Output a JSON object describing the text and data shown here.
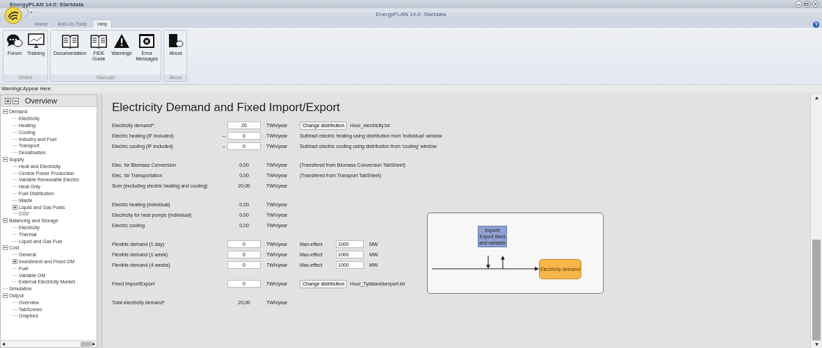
{
  "window": {
    "title": "EnergyPLAN 14.0: Startdata"
  },
  "app_title": "EnergyPLAN 14.0: Startdata",
  "tabs": [
    {
      "label": "Home",
      "selected": false
    },
    {
      "label": "Add-On Tools",
      "selected": false
    },
    {
      "label": "Help",
      "selected": true
    }
  ],
  "ribbon_groups": [
    {
      "label": "Online",
      "buttons": [
        "Forum",
        "Training"
      ]
    },
    {
      "label": "Manuals",
      "buttons": [
        "Documentation",
        "FIDE Guide",
        "Warnings",
        "Error Messages"
      ]
    },
    {
      "label": "About",
      "buttons": [
        "About"
      ]
    }
  ],
  "warnings_label": "Warnings Appear Here:",
  "sidebar": {
    "title": "Overview",
    "tree": [
      {
        "label": "Demand",
        "expanded": true,
        "children": [
          {
            "label": "Electricity"
          },
          {
            "label": "Heating"
          },
          {
            "label": "Cooling"
          },
          {
            "label": "Industry and Fuel"
          },
          {
            "label": "Transport"
          },
          {
            "label": "Desalination"
          }
        ]
      },
      {
        "label": "Supply",
        "expanded": true,
        "children": [
          {
            "label": "Heat and Electricity"
          },
          {
            "label": "Central Power Production"
          },
          {
            "label": "Variable Renewable Electric"
          },
          {
            "label": "Heat Only"
          },
          {
            "label": "Fuel Distribution"
          },
          {
            "label": "Waste"
          },
          {
            "label": "Liquid and Gas Fuels",
            "expanded": false
          },
          {
            "label": "CO2"
          }
        ]
      },
      {
        "label": "Balancing and Storage",
        "expanded": true,
        "children": [
          {
            "label": "Electricity"
          },
          {
            "label": "Thermal"
          },
          {
            "label": "Liquid and Gas Fuel"
          }
        ]
      },
      {
        "label": "Cost",
        "expanded": true,
        "children": [
          {
            "label": "General"
          },
          {
            "label": "Investment and Fixed OM",
            "expanded": false
          },
          {
            "label": "Fuel"
          },
          {
            "label": "Variable OM"
          },
          {
            "label": "External Electricity Market"
          }
        ]
      },
      {
        "label": "Simulation"
      },
      {
        "label": "Output",
        "expanded": true,
        "children": [
          {
            "label": "Overview"
          },
          {
            "label": "TabScreen"
          },
          {
            "label": "Graphics"
          }
        ]
      }
    ]
  },
  "page": {
    "title": "Electricity Demand and Fixed Import/Export",
    "sections": [
      {
        "rows": [
          {
            "label": "Electricity demand*:",
            "kind": "input",
            "value": "20",
            "unit": "TWh/year",
            "button": "Change distribution",
            "file": "Hour_electricity.txt"
          },
          {
            "label": "Electric heating (IF included)",
            "prefix": "–",
            "kind": "input",
            "value": "0",
            "unit": "TWh/year",
            "note": "Subtract electric heating using distribution from 'individual' window"
          },
          {
            "label": "Electric cooling (IF included)",
            "prefix": "–",
            "kind": "input",
            "value": "0",
            "unit": "TWh/year",
            "note": "Subtract electric cooling using distribution from 'cooling' window"
          }
        ]
      },
      {
        "rows": [
          {
            "label": "Elec. for Biomass Conversion",
            "kind": "value",
            "value": "0,00",
            "unit": "TWh/year",
            "note": "(Transfered from Biomass Conversion TabSheet)"
          },
          {
            "label": "Elec. for Transportation",
            "kind": "value",
            "value": "0,00",
            "unit": "TWh/year",
            "note": "(Transfered from Transport TabSheet)"
          },
          {
            "label": "Sum (excluding electric heating and cooling)",
            "kind": "value",
            "value": "20,00",
            "unit": "TWh/year"
          }
        ]
      },
      {
        "rows": [
          {
            "label": "Electric heating (individual)",
            "kind": "value",
            "value": "0,00",
            "unit": "TWh/year"
          },
          {
            "label": "Electricity for heat pumps (individual)",
            "kind": "value",
            "value": "0,00",
            "unit": "TWh/year"
          },
          {
            "label": "Electric cooling",
            "kind": "value",
            "value": "0,00",
            "unit": "TWh/year"
          }
        ]
      },
      {
        "rows": [
          {
            "label": "Flexible demand (1 day)",
            "kind": "input",
            "value": "0",
            "unit": "TWh/year",
            "max_label": "Max-effect",
            "max_value": "1000",
            "max_unit": "MW"
          },
          {
            "label": "Flexible demand (1 week)",
            "kind": "input",
            "value": "0",
            "unit": "TWh/year",
            "max_label": "Max-effect",
            "max_value": "1000",
            "max_unit": "MW"
          },
          {
            "label": "Flexible demand (4 weeks)",
            "kind": "input",
            "value": "0",
            "unit": "TWh/year",
            "max_label": "Max-effect",
            "max_value": "1000",
            "max_unit": "MW"
          }
        ]
      },
      {
        "rows": [
          {
            "label": "Fixed Import/Export",
            "kind": "input",
            "value": "0",
            "unit": "TWh/year",
            "button": "Change distribution",
            "file": "Hour_Tysklandsexport.txt"
          }
        ]
      },
      {
        "rows": [
          {
            "label": "Total electricity demand*",
            "kind": "value",
            "value": "20,00",
            "unit": "TWh/year"
          }
        ]
      }
    ],
    "diagram": {
      "source": "Import/ Export fixed and variable",
      "target": "Electricity demand"
    }
  }
}
